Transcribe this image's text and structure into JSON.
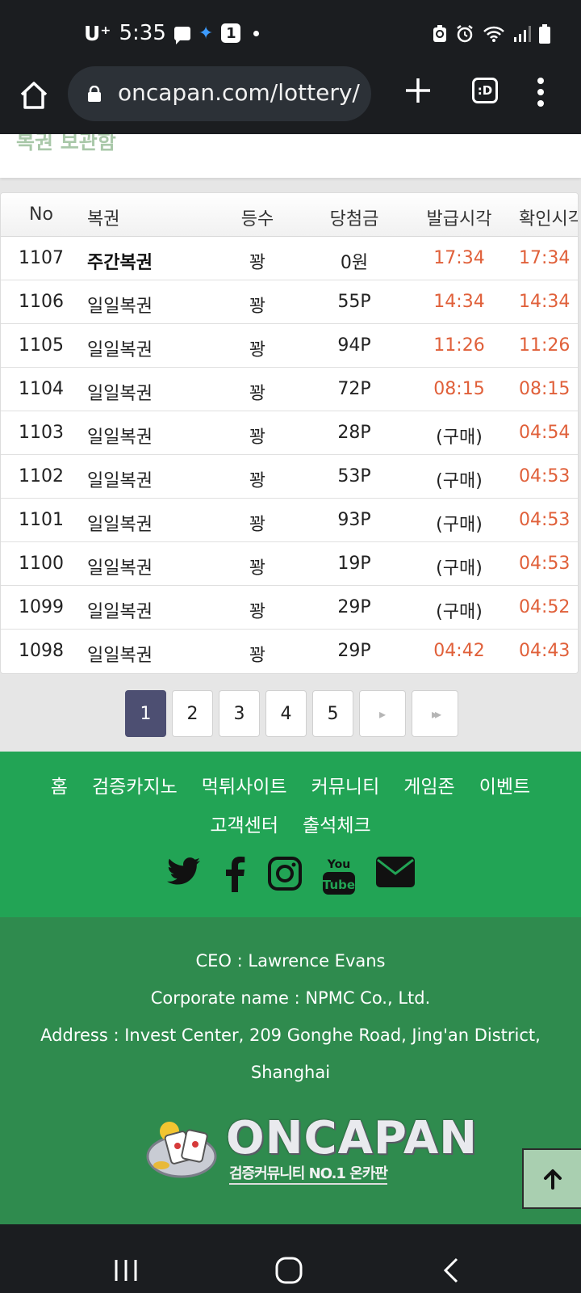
{
  "status_bar": {
    "carrier": "U⁺",
    "time": "5:35",
    "notification_count": "1"
  },
  "browser": {
    "url": "oncapan.com/lottery/",
    "tabs_label": ":D"
  },
  "page": {
    "section_title": "복권 보관함"
  },
  "table": {
    "headers": [
      "No",
      "복권",
      "등수",
      "당첨금",
      "발급시각",
      "확인시각"
    ],
    "rows": [
      {
        "no": "1107",
        "name": "주간복권",
        "rank": "꽝",
        "prize": "0원",
        "issued": "17:34",
        "checked": "17:34"
      },
      {
        "no": "1106",
        "name": "일일복권",
        "rank": "꽝",
        "prize": "55P",
        "issued": "14:34",
        "checked": "14:34"
      },
      {
        "no": "1105",
        "name": "일일복권",
        "rank": "꽝",
        "prize": "94P",
        "issued": "11:26",
        "checked": "11:26"
      },
      {
        "no": "1104",
        "name": "일일복권",
        "rank": "꽝",
        "prize": "72P",
        "issued": "08:15",
        "checked": "08:15"
      },
      {
        "no": "1103",
        "name": "일일복권",
        "rank": "꽝",
        "prize": "28P",
        "issued": "(구매)",
        "checked": "04:54"
      },
      {
        "no": "1102",
        "name": "일일복권",
        "rank": "꽝",
        "prize": "53P",
        "issued": "(구매)",
        "checked": "04:53"
      },
      {
        "no": "1101",
        "name": "일일복권",
        "rank": "꽝",
        "prize": "93P",
        "issued": "(구매)",
        "checked": "04:53"
      },
      {
        "no": "1100",
        "name": "일일복권",
        "rank": "꽝",
        "prize": "19P",
        "issued": "(구매)",
        "checked": "04:53"
      },
      {
        "no": "1099",
        "name": "일일복권",
        "rank": "꽝",
        "prize": "29P",
        "issued": "(구매)",
        "checked": "04:52"
      },
      {
        "no": "1098",
        "name": "일일복권",
        "rank": "꽝",
        "prize": "29P",
        "issued": "04:42",
        "checked": "04:43"
      }
    ]
  },
  "pagination": {
    "pages": [
      "1",
      "2",
      "3",
      "4",
      "5"
    ],
    "current": "1",
    "next_icon": "▸",
    "last_icon": "▸▸"
  },
  "footer": {
    "nav_row1": [
      "홈",
      "검증카지노",
      "먹튀사이트",
      "커뮤니티",
      "게임존",
      "이벤트"
    ],
    "nav_row2": [
      "고객센터",
      "출석체크"
    ],
    "social_icons": [
      "twitter-icon",
      "facebook-icon",
      "instagram-icon",
      "youtube-icon",
      "mail-icon"
    ],
    "youtube_top": "You",
    "youtube_bottom": "Tube",
    "ceo": "CEO : Lawrence Evans",
    "corporate": "Corporate name : NPMC Co., Ltd.",
    "address_line1": "Address : Invest Center, 209 Gonghe Road, Jing'an District,",
    "address_line2": "Shanghai",
    "logo_text": "ONCAPAN",
    "logo_sub": "검증커뮤니티 NO.1 온카판",
    "top_button_icon": "↑"
  },
  "colors": {
    "status_bg": "#1b1d20",
    "time_red": "#e0603a",
    "footer_green": "#22a455",
    "footer_dark_green": "#2f8b4e",
    "active_page": "#4d4f72"
  }
}
